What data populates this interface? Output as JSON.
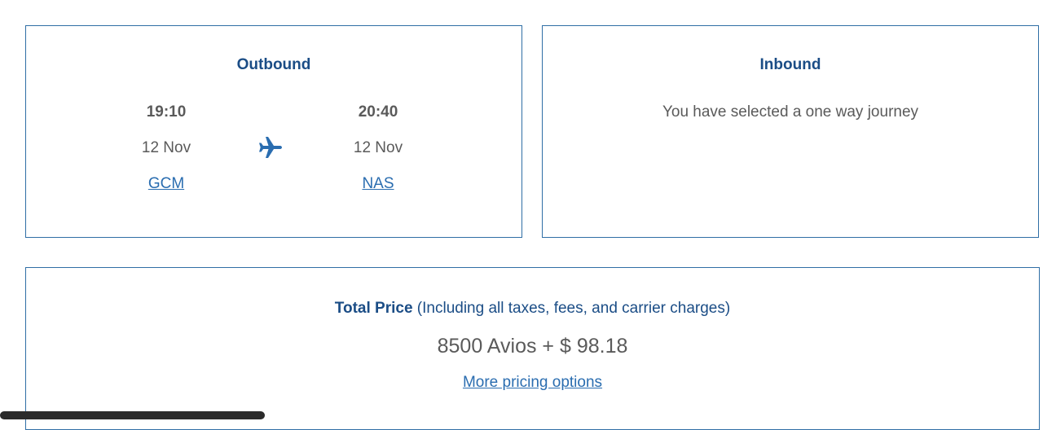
{
  "outbound": {
    "title": "Outbound",
    "departure": {
      "time": "19:10",
      "date": "12 Nov",
      "airport": "GCM"
    },
    "arrival": {
      "time": "20:40",
      "date": "12 Nov",
      "airport": "NAS"
    },
    "icon": "plane-icon"
  },
  "inbound": {
    "title": "Inbound",
    "message": "You have selected a one way journey"
  },
  "total": {
    "label": "Total Price",
    "note": " (Including all taxes, fees, and carrier charges)",
    "price": "8500 Avios + $ 98.18",
    "more_link": "More pricing options"
  },
  "colors": {
    "border": "#2f6ea5",
    "heading": "#1b4d86",
    "link": "#2a6db0",
    "text": "#5a5a5a"
  }
}
